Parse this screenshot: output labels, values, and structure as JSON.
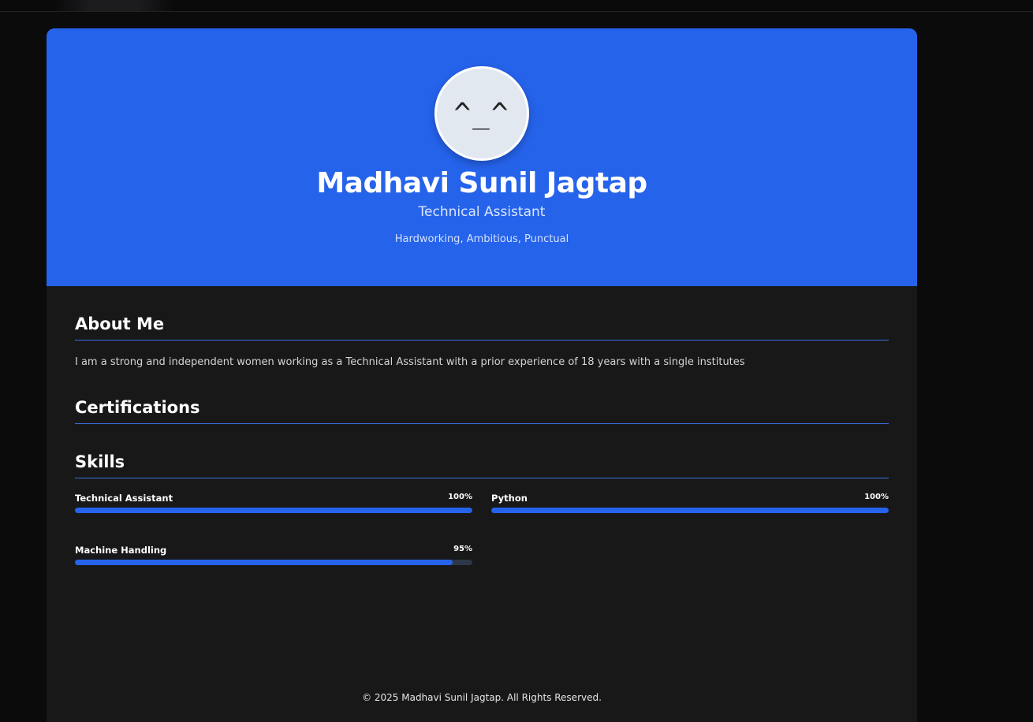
{
  "profile": {
    "avatar_text": "^_^",
    "name": "Madhavi Sunil Jagtap",
    "role": "Technical Assistant",
    "tagline": "Hardworking, Ambitious, Punctual"
  },
  "about": {
    "title": "About Me",
    "text": "I am a strong and independent women working as a Technical Assistant with a prior experience of 18 years with a single institutes"
  },
  "certifications": {
    "title": "Certifications"
  },
  "skills": {
    "title": "Skills",
    "items": [
      {
        "name": "Technical Assistant",
        "percent_label": "100%",
        "percent": 100
      },
      {
        "name": "Python",
        "percent_label": "100%",
        "percent": 100
      },
      {
        "name": "Machine Handling",
        "percent_label": "95%",
        "percent": 95
      }
    ]
  },
  "footer": {
    "text": "© 2025 Madhavi Sunil Jagtap. All Rights Reserved."
  },
  "colors": {
    "accent": "#2563eb",
    "background": "#181818",
    "bar_track": "#2d3748"
  }
}
